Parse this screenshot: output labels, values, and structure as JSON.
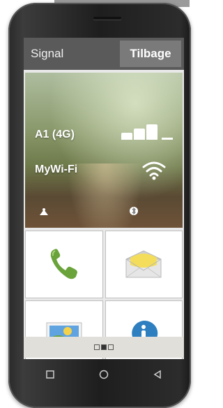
{
  "header": {
    "title": "Signal",
    "back_label": "Tilbage"
  },
  "status": {
    "network_label": "A1 (4G)",
    "wifi_label": "MyWi-Fi",
    "signal_level": 3
  },
  "pager": {
    "pages": 3,
    "active_page": 2
  },
  "icons": {
    "phone": "phone-icon",
    "message": "envelope-icon",
    "gallery": "gallery-icon",
    "info": "info-icon"
  },
  "colors": {
    "header_bg": "#5a5a5a",
    "back_button_bg": "#7a7a7a",
    "phone_green": "#6aa33a",
    "info_blue": "#2e7fc0"
  }
}
